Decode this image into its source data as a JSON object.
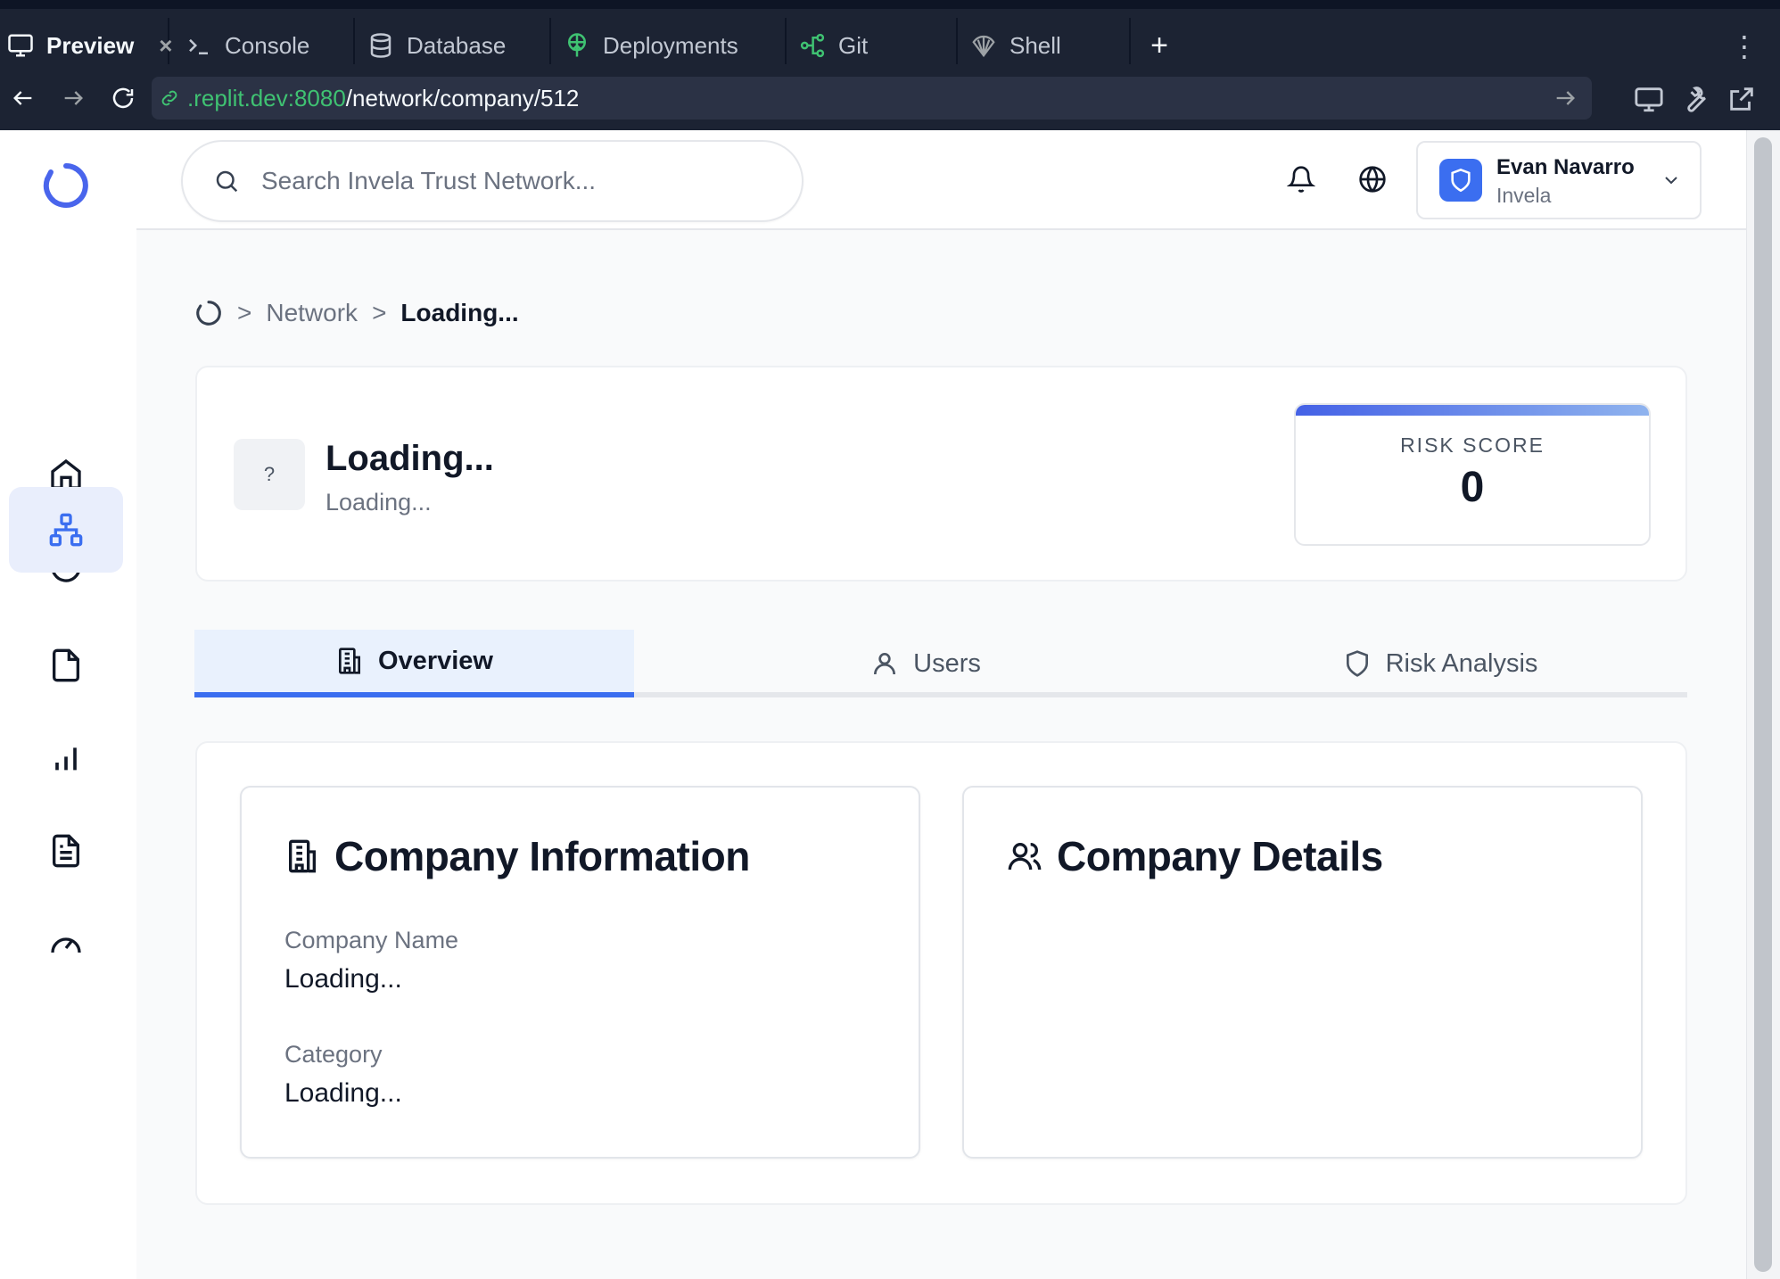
{
  "ide": {
    "tabs": [
      {
        "label": "Preview",
        "icon": "monitor-icon",
        "active": true
      },
      {
        "label": "Console",
        "icon": "terminal-icon"
      },
      {
        "label": "Database",
        "icon": "database-icon"
      },
      {
        "label": "Deployments",
        "icon": "deployments-icon"
      },
      {
        "label": "Git",
        "icon": "git-icon"
      },
      {
        "label": "Shell",
        "icon": "shell-icon"
      }
    ],
    "close_glyph": "×",
    "add_glyph": "+",
    "menu_glyph": "⋮",
    "url": {
      "host": ".replit.dev:8080",
      "path": "/network/company/512"
    }
  },
  "header": {
    "search_placeholder": "Search Invela Trust Network...",
    "user": {
      "name": "Evan Navarro",
      "org": "Invela"
    }
  },
  "sidebar": {
    "items": [
      {
        "name": "home",
        "icon": "home-icon"
      },
      {
        "name": "tasks",
        "icon": "check-circle-icon"
      },
      {
        "name": "network",
        "icon": "network-icon",
        "active": true
      },
      {
        "name": "files",
        "icon": "file-icon"
      },
      {
        "name": "insights",
        "icon": "bar-chart-icon"
      },
      {
        "name": "documents",
        "icon": "document-icon"
      },
      {
        "name": "performance",
        "icon": "gauge-icon"
      }
    ]
  },
  "breadcrumb": {
    "sep": ">",
    "network": "Network",
    "current": "Loading..."
  },
  "company": {
    "avatar_text": "?",
    "title": "Loading...",
    "subtitle": "Loading...",
    "risk_label": "RISK SCORE",
    "risk_value": "0"
  },
  "tabs": [
    {
      "label": "Overview",
      "icon": "building-icon",
      "active": true
    },
    {
      "label": "Users",
      "icon": "user-icon"
    },
    {
      "label": "Risk Analysis",
      "icon": "shield-icon"
    }
  ],
  "panels": {
    "info": {
      "title": "Company Information",
      "fields": [
        {
          "label": "Company Name",
          "value": "Loading..."
        },
        {
          "label": "Category",
          "value": "Loading..."
        }
      ]
    },
    "details": {
      "title": "Company Details"
    }
  },
  "colors": {
    "accent": "#3b6ef0",
    "url_host": "#3fc272",
    "ide_bg": "#1c2333"
  }
}
